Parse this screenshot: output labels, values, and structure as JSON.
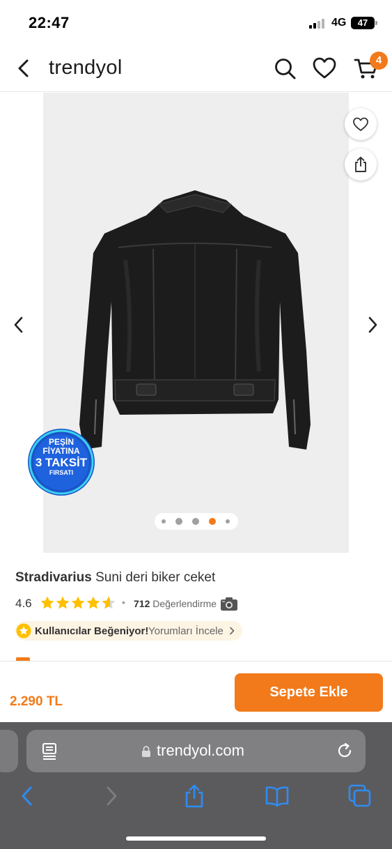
{
  "status_bar": {
    "time": "22:47",
    "network": "4G",
    "battery": "47"
  },
  "header": {
    "brand": "trendyol",
    "cart_count": "4",
    "icons": [
      "back-icon",
      "search-icon",
      "heart-icon",
      "cart-icon"
    ]
  },
  "gallery": {
    "image_count": 5,
    "active_index": 3,
    "promo_badge": {
      "line1": "PEŞİN",
      "line2": "FİYATINA",
      "line3": "3 TAKSİT",
      "line4": "FIRSATI"
    }
  },
  "product": {
    "brand": "Stradivarius",
    "name": "Suni deri biker ceket",
    "rating": "4.6",
    "rating_value": 4.6,
    "review_count": "712",
    "review_label": "Değerlendirme",
    "likes_label": "Kullanıcılar Beğeniyor!",
    "likes_link": "Yorumları İncele"
  },
  "buy_bar": {
    "price": "2.290 TL",
    "add_to_cart": "Sepete Ekle"
  },
  "browser": {
    "url": "trendyol.com"
  },
  "colors": {
    "accent": "#f27a1a",
    "star": "#ffc000",
    "safari_bar": "#5b5b5e",
    "promo_blue": "#1a55c8"
  }
}
